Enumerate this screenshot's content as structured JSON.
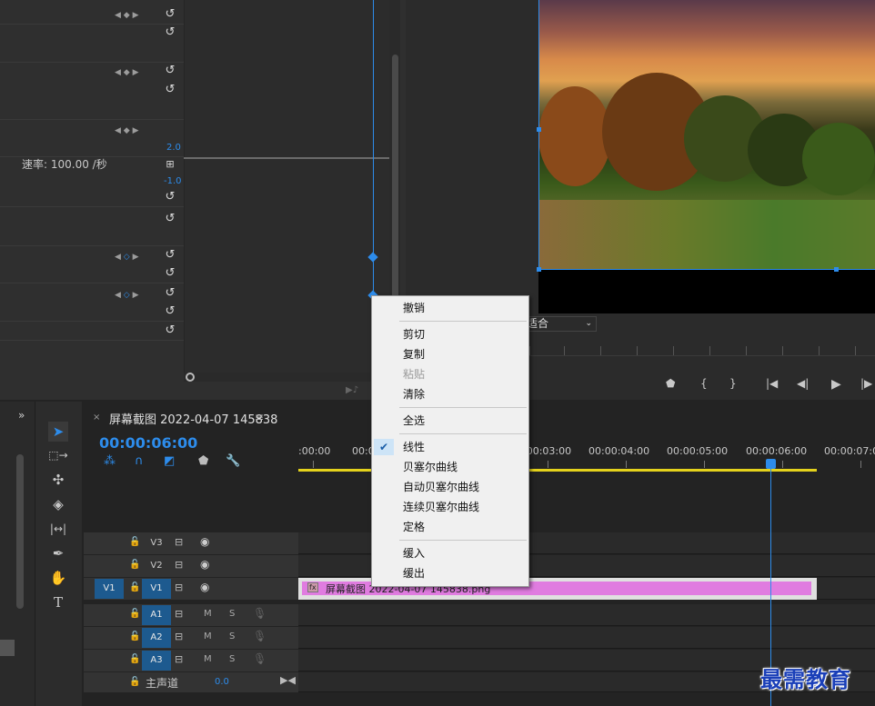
{
  "effect_controls": {
    "speed_label": "速率: 100.00 /秒",
    "graph_max": "2.0",
    "graph_min": "-1.0"
  },
  "program_monitor": {
    "fit_select": "适合"
  },
  "timeline": {
    "tab_close": "×",
    "tab_title": "屏幕截图 2022-04-07 145838",
    "tab_menu": "≡",
    "timecode": "00:00:06:00",
    "ruler_labels": [
      ":00:00",
      "00:00",
      "00:00:03:00",
      "00:00:04:00",
      "00:00:05:00",
      "00:00:06:00",
      "00:00:07:00"
    ],
    "tracks": {
      "V3": "V3",
      "V2": "V2",
      "V1": "V1",
      "V1_source": "V1",
      "A1": "A1",
      "A2": "A2",
      "A3": "A3"
    },
    "mute_label": "M",
    "solo_label": "S",
    "master_label": "主声道",
    "master_value": "0.0",
    "clip": {
      "fx": "fx",
      "name": "屏幕截图 2022-04-07 145838.png"
    }
  },
  "context_menu": {
    "undo": "撤销",
    "cut": "剪切",
    "copy": "复制",
    "paste": "粘贴",
    "clear": "清除",
    "select_all": "全选",
    "linear": "线性",
    "bezier": "贝塞尔曲线",
    "auto_bezier": "自动贝塞尔曲线",
    "continuous_bezier": "连续贝塞尔曲线",
    "hold": "定格",
    "ease_in": "缓入",
    "ease_out": "缓出",
    "checked_item": "线性"
  },
  "watermark": "最需教育",
  "colors": {
    "accent": "#2d8ceb",
    "clip": "#e07ce0",
    "workarea": "#e4d21c",
    "track_on": "#1d5a8f"
  }
}
